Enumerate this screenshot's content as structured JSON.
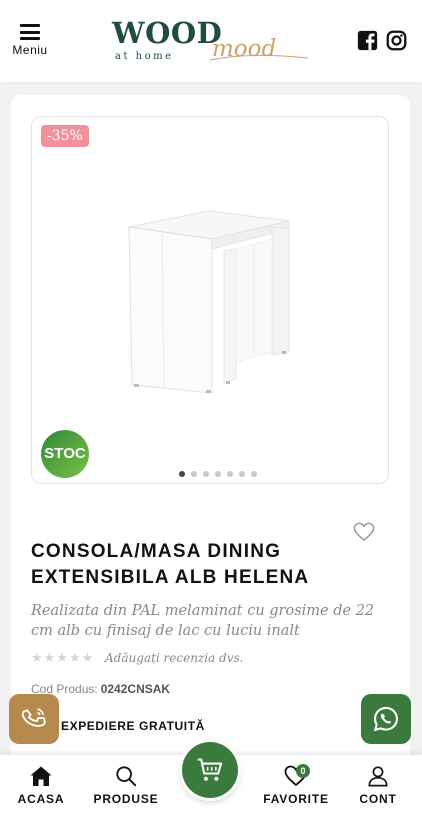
{
  "header": {
    "menu_label": "Meniu",
    "logo_wood": "WOOD",
    "logo_athome": "at home",
    "logo_mood": "mood",
    "social_icons": [
      "facebook-icon",
      "instagram-icon"
    ]
  },
  "product": {
    "discount_badge": "-35%",
    "stock_badge": "STOC",
    "gallery_dots": 7,
    "gallery_active_index": 0,
    "title": "CONSOLA/MASA DINING EXTENSIBILA ALB HELENA",
    "description": "Realizata din PAL melaminat cu grosime de 22 cm alb cu finisaj de lac cu luciu inalt",
    "rating_stars": 0,
    "review_link": "Adăugați recenzia dvs.",
    "code_label": "Cod Produs:",
    "code_value": "0242CNSAK",
    "shipping": "EXPEDIERE GRATUITĂ"
  },
  "bottom_nav": {
    "items": [
      {
        "label": "ACASA",
        "icon": "home-icon"
      },
      {
        "label": "PRODUSE",
        "icon": "search-icon"
      },
      {
        "label": "FAVORITE",
        "icon": "heart-icon"
      },
      {
        "label": "CONT",
        "icon": "user-icon"
      }
    ],
    "favorites_count": "0",
    "cart_icon": "cart-icon"
  },
  "colors": {
    "brand_green": "#3b7a3d",
    "brand_gold": "#b58a4c",
    "discount_pink": "#f2909c"
  }
}
